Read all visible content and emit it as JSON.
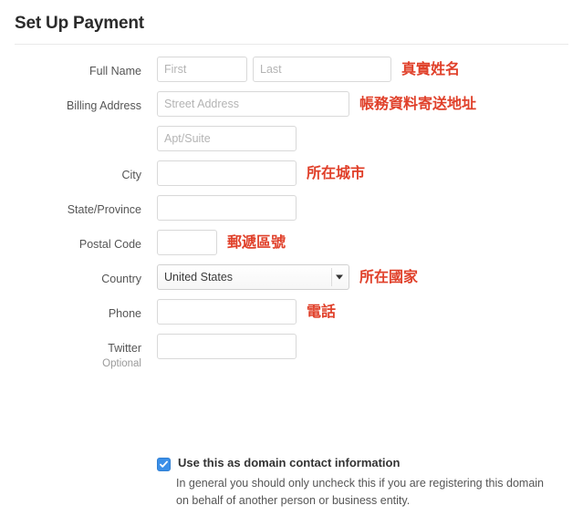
{
  "header": {
    "title": "Set Up Payment"
  },
  "form": {
    "fields": [
      {
        "label": "Full Name",
        "inputs": [
          {
            "name": "first-name-input",
            "placeholder": "First",
            "value": ""
          },
          {
            "name": "last-name-input",
            "placeholder": "Last",
            "value": ""
          }
        ],
        "annotation": "真實姓名"
      },
      {
        "label": "Billing Address",
        "inputs": [
          {
            "name": "street-address-input",
            "placeholder": "Street Address",
            "value": ""
          }
        ],
        "annotation": "帳務資料寄送地址"
      },
      {
        "label": "",
        "inputs": [
          {
            "name": "apt-suite-input",
            "placeholder": "Apt/Suite",
            "value": ""
          }
        ],
        "annotation": ""
      },
      {
        "label": "City",
        "inputs": [
          {
            "name": "city-input",
            "placeholder": "",
            "value": ""
          }
        ],
        "annotation": "所在城市"
      },
      {
        "label": "State/Province",
        "inputs": [
          {
            "name": "state-province-input",
            "placeholder": "",
            "value": ""
          }
        ],
        "annotation": ""
      },
      {
        "label": "Postal Code",
        "inputs": [
          {
            "name": "postal-code-input",
            "placeholder": "",
            "value": ""
          }
        ],
        "annotation": "郵遞區號"
      },
      {
        "label": "Country",
        "select": {
          "name": "country-select",
          "value": "United States"
        },
        "annotation": "所在國家"
      },
      {
        "label": "Phone",
        "inputs": [
          {
            "name": "phone-input",
            "placeholder": "",
            "value": ""
          }
        ],
        "annotation": "電話"
      },
      {
        "label": "Twitter",
        "sublabel": "Optional",
        "inputs": [
          {
            "name": "twitter-input",
            "placeholder": "",
            "value": ""
          }
        ],
        "annotation": ""
      }
    ]
  },
  "domain_contact": {
    "checked": true,
    "label": "Use this as domain contact information",
    "description": "In general you should only uncheck this if you are registering this domain on behalf of another person or business entity."
  },
  "colors": {
    "annotation_red": "#e0402a",
    "checkbox_blue": "#3b8fe8",
    "input_border": "#d9d9d9",
    "text": "#333333"
  }
}
